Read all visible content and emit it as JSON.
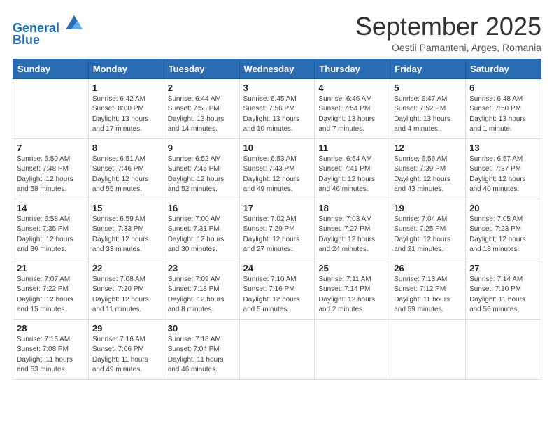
{
  "header": {
    "logo_line1": "General",
    "logo_line2": "Blue",
    "month": "September 2025",
    "location": "Oestii Pamanteni, Arges, Romania"
  },
  "days_of_week": [
    "Sunday",
    "Monday",
    "Tuesday",
    "Wednesday",
    "Thursday",
    "Friday",
    "Saturday"
  ],
  "weeks": [
    [
      {
        "day": "",
        "info": ""
      },
      {
        "day": "1",
        "info": "Sunrise: 6:42 AM\nSunset: 8:00 PM\nDaylight: 13 hours\nand 17 minutes."
      },
      {
        "day": "2",
        "info": "Sunrise: 6:44 AM\nSunset: 7:58 PM\nDaylight: 13 hours\nand 14 minutes."
      },
      {
        "day": "3",
        "info": "Sunrise: 6:45 AM\nSunset: 7:56 PM\nDaylight: 13 hours\nand 10 minutes."
      },
      {
        "day": "4",
        "info": "Sunrise: 6:46 AM\nSunset: 7:54 PM\nDaylight: 13 hours\nand 7 minutes."
      },
      {
        "day": "5",
        "info": "Sunrise: 6:47 AM\nSunset: 7:52 PM\nDaylight: 13 hours\nand 4 minutes."
      },
      {
        "day": "6",
        "info": "Sunrise: 6:48 AM\nSunset: 7:50 PM\nDaylight: 13 hours\nand 1 minute."
      }
    ],
    [
      {
        "day": "7",
        "info": "Sunrise: 6:50 AM\nSunset: 7:48 PM\nDaylight: 12 hours\nand 58 minutes."
      },
      {
        "day": "8",
        "info": "Sunrise: 6:51 AM\nSunset: 7:46 PM\nDaylight: 12 hours\nand 55 minutes."
      },
      {
        "day": "9",
        "info": "Sunrise: 6:52 AM\nSunset: 7:45 PM\nDaylight: 12 hours\nand 52 minutes."
      },
      {
        "day": "10",
        "info": "Sunrise: 6:53 AM\nSunset: 7:43 PM\nDaylight: 12 hours\nand 49 minutes."
      },
      {
        "day": "11",
        "info": "Sunrise: 6:54 AM\nSunset: 7:41 PM\nDaylight: 12 hours\nand 46 minutes."
      },
      {
        "day": "12",
        "info": "Sunrise: 6:56 AM\nSunset: 7:39 PM\nDaylight: 12 hours\nand 43 minutes."
      },
      {
        "day": "13",
        "info": "Sunrise: 6:57 AM\nSunset: 7:37 PM\nDaylight: 12 hours\nand 40 minutes."
      }
    ],
    [
      {
        "day": "14",
        "info": "Sunrise: 6:58 AM\nSunset: 7:35 PM\nDaylight: 12 hours\nand 36 minutes."
      },
      {
        "day": "15",
        "info": "Sunrise: 6:59 AM\nSunset: 7:33 PM\nDaylight: 12 hours\nand 33 minutes."
      },
      {
        "day": "16",
        "info": "Sunrise: 7:00 AM\nSunset: 7:31 PM\nDaylight: 12 hours\nand 30 minutes."
      },
      {
        "day": "17",
        "info": "Sunrise: 7:02 AM\nSunset: 7:29 PM\nDaylight: 12 hours\nand 27 minutes."
      },
      {
        "day": "18",
        "info": "Sunrise: 7:03 AM\nSunset: 7:27 PM\nDaylight: 12 hours\nand 24 minutes."
      },
      {
        "day": "19",
        "info": "Sunrise: 7:04 AM\nSunset: 7:25 PM\nDaylight: 12 hours\nand 21 minutes."
      },
      {
        "day": "20",
        "info": "Sunrise: 7:05 AM\nSunset: 7:23 PM\nDaylight: 12 hours\nand 18 minutes."
      }
    ],
    [
      {
        "day": "21",
        "info": "Sunrise: 7:07 AM\nSunset: 7:22 PM\nDaylight: 12 hours\nand 15 minutes."
      },
      {
        "day": "22",
        "info": "Sunrise: 7:08 AM\nSunset: 7:20 PM\nDaylight: 12 hours\nand 11 minutes."
      },
      {
        "day": "23",
        "info": "Sunrise: 7:09 AM\nSunset: 7:18 PM\nDaylight: 12 hours\nand 8 minutes."
      },
      {
        "day": "24",
        "info": "Sunrise: 7:10 AM\nSunset: 7:16 PM\nDaylight: 12 hours\nand 5 minutes."
      },
      {
        "day": "25",
        "info": "Sunrise: 7:11 AM\nSunset: 7:14 PM\nDaylight: 12 hours\nand 2 minutes."
      },
      {
        "day": "26",
        "info": "Sunrise: 7:13 AM\nSunset: 7:12 PM\nDaylight: 11 hours\nand 59 minutes."
      },
      {
        "day": "27",
        "info": "Sunrise: 7:14 AM\nSunset: 7:10 PM\nDaylight: 11 hours\nand 56 minutes."
      }
    ],
    [
      {
        "day": "28",
        "info": "Sunrise: 7:15 AM\nSunset: 7:08 PM\nDaylight: 11 hours\nand 53 minutes."
      },
      {
        "day": "29",
        "info": "Sunrise: 7:16 AM\nSunset: 7:06 PM\nDaylight: 11 hours\nand 49 minutes."
      },
      {
        "day": "30",
        "info": "Sunrise: 7:18 AM\nSunset: 7:04 PM\nDaylight: 11 hours\nand 46 minutes."
      },
      {
        "day": "",
        "info": ""
      },
      {
        "day": "",
        "info": ""
      },
      {
        "day": "",
        "info": ""
      },
      {
        "day": "",
        "info": ""
      }
    ]
  ]
}
